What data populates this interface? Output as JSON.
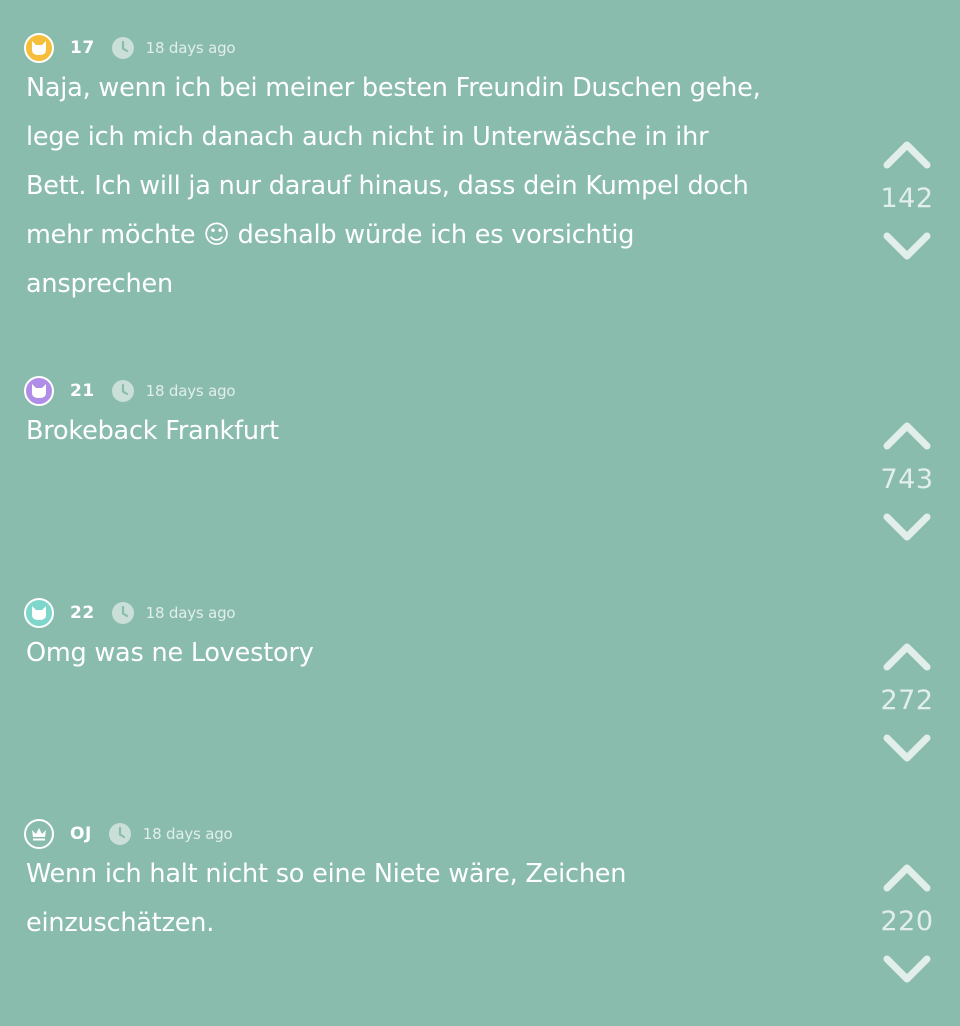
{
  "colors": {
    "background": "#8abcae",
    "text": "#ffffff",
    "muted": "#e2eee9",
    "badge_orange": "#f7be3c",
    "badge_purple": "#b08ee8",
    "badge_teal": "#7fd7cc",
    "badge_crown": "#8abcae"
  },
  "replies": [
    {
      "badge_icon": "cat-icon",
      "badge_color": "#f7be3c",
      "handle": "17",
      "time": "18 days ago",
      "text": "Naja, wenn ich bei meiner besten Freundin Duschen gehe, lege ich mich danach auch nicht in Unterwäsche in ihr Bett. Ich will ja nur darauf hinaus, dass dein Kumpel doch mehr möchte ☺ deshalb würde ich es vorsichtig ansprechen",
      "votes": "142"
    },
    {
      "badge_icon": "cat-icon",
      "badge_color": "#b08ee8",
      "handle": "21",
      "time": "18 days ago",
      "text": "Brokeback Frankfurt",
      "votes": "743"
    },
    {
      "badge_icon": "cat-icon",
      "badge_color": "#7fd7cc",
      "handle": "22",
      "time": "18 days ago",
      "text": "Omg was ne Lovestory",
      "votes": "272"
    },
    {
      "badge_icon": "crown-icon",
      "badge_color": "#8abcae",
      "handle": "OJ",
      "time": "18 days ago",
      "text": "Wenn ich halt nicht so eine Niete wäre, Zeichen einzuschätzen.",
      "votes": "220"
    }
  ]
}
